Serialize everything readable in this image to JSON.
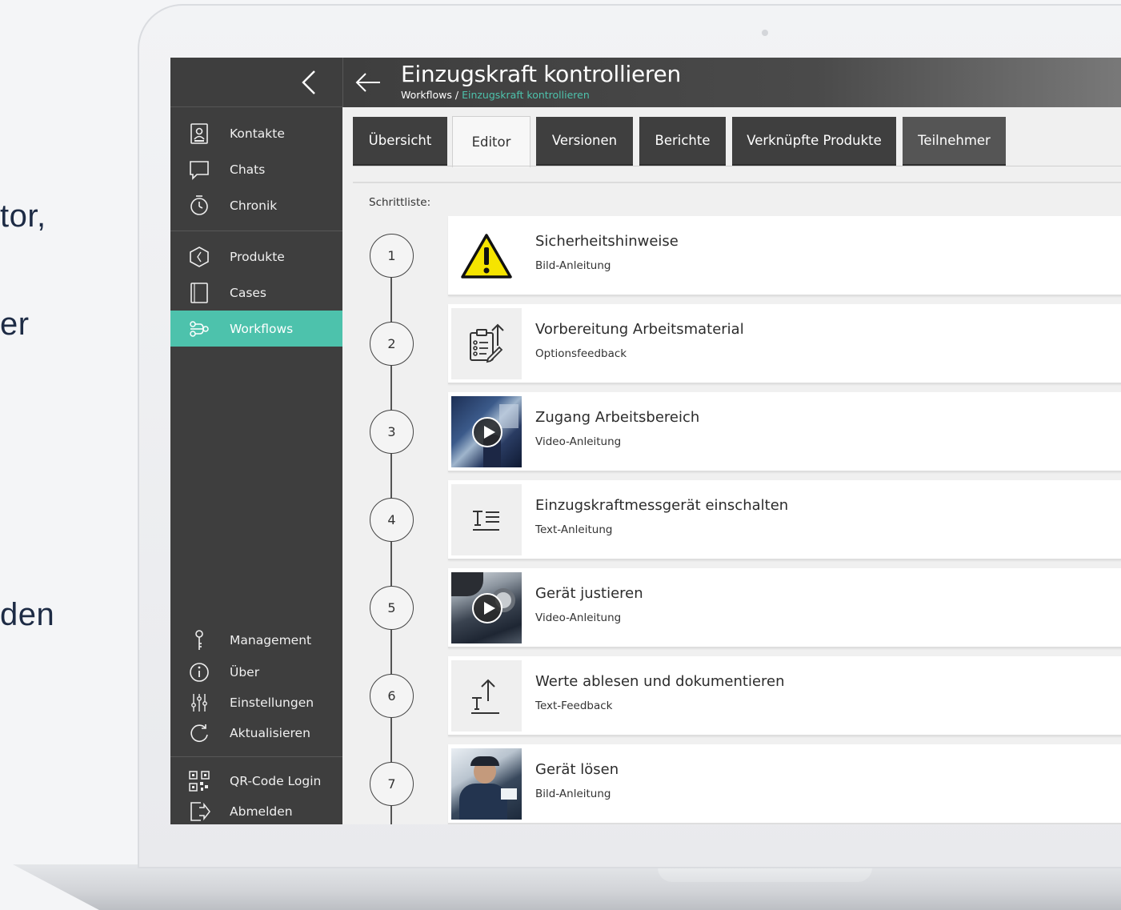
{
  "marketing": {
    "fragments": [
      "tor,",
      "er",
      "den"
    ]
  },
  "sidebar": {
    "top_items": [
      {
        "label": "Kontakte",
        "icon": "contact-book-icon"
      },
      {
        "label": "Chats",
        "icon": "chat-bubble-icon"
      },
      {
        "label": "Chronik",
        "icon": "stopwatch-icon"
      }
    ],
    "mid_items": [
      {
        "label": "Produkte",
        "icon": "hexagon-icon"
      },
      {
        "label": "Cases",
        "icon": "document-icon"
      },
      {
        "label": "Workflows",
        "icon": "workflow-icon",
        "active": true
      }
    ],
    "bottom_items": [
      {
        "label": "Management",
        "icon": "key-icon"
      },
      {
        "label": "Über",
        "icon": "info-icon"
      },
      {
        "label": "Einstellungen",
        "icon": "sliders-icon"
      },
      {
        "label": "Aktualisieren",
        "icon": "refresh-icon"
      }
    ],
    "footer_items": [
      {
        "label": "QR-Code Login",
        "icon": "qr-code-icon"
      },
      {
        "label": "Abmelden",
        "icon": "logout-icon"
      }
    ]
  },
  "header": {
    "title": "Einzugskraft kontrollieren",
    "breadcrumb_root": "Workflows / ",
    "breadcrumb_current": "Einzugskraft kontrollieren"
  },
  "tabs": [
    {
      "label": "Übersicht"
    },
    {
      "label": "Editor",
      "active": true
    },
    {
      "label": "Versionen"
    },
    {
      "label": "Berichte"
    },
    {
      "label": "Verknüpfte Produkte"
    },
    {
      "label": "Teilnehmer"
    }
  ],
  "steps_label": "Schrittliste:",
  "steps": [
    {
      "number": "1",
      "title": "Sicherheitshinweise",
      "type": "Bild-Anleitung",
      "thumb": "warning-icon"
    },
    {
      "number": "2",
      "title": "Vorbereitung Arbeitsmaterial",
      "type": "Optionsfeedback",
      "thumb": "clipboard-edit-icon"
    },
    {
      "number": "3",
      "title": "Zugang Arbeitsbereich",
      "type": "Video-Anleitung",
      "thumb": "video-thumbnail"
    },
    {
      "number": "4",
      "title": "Einzugskraftmessgerät einschalten",
      "type": "Text-Anleitung",
      "thumb": "text-icon"
    },
    {
      "number": "5",
      "title": "Gerät justieren",
      "type": "Video-Anleitung",
      "thumb": "video-thumbnail"
    },
    {
      "number": "6",
      "title": "Werte ablesen und dokumentieren",
      "type": "Text-Feedback",
      "thumb": "text-upload-icon"
    },
    {
      "number": "7",
      "title": "Gerät lösen",
      "type": "Bild-Anleitung",
      "thumb": "photo-thumbnail"
    }
  ],
  "colors": {
    "accent": "#4dc2ac",
    "sidebar_bg": "#3e3e3e",
    "tab_bg": "#3f3f3f",
    "text_dark": "#1d2b45"
  }
}
